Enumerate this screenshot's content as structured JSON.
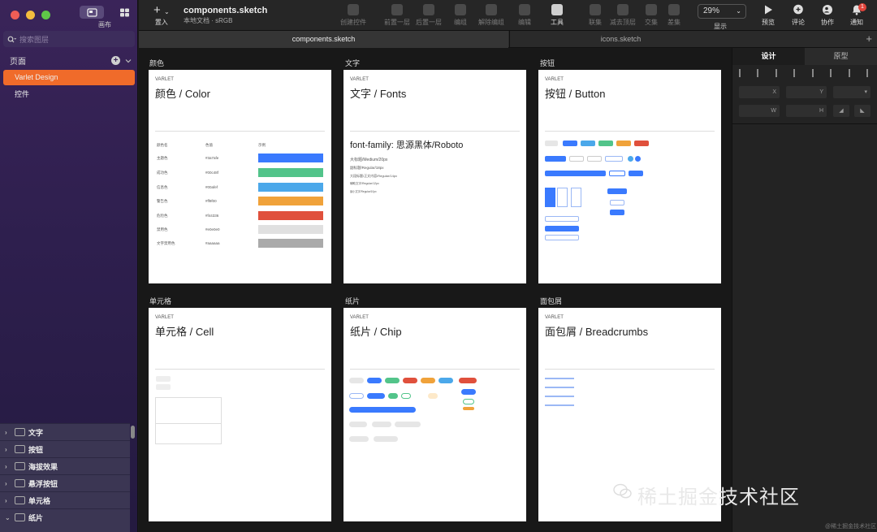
{
  "sidebar": {
    "canvas_label": "画布",
    "search_placeholder": "搜索图层",
    "pages_title": "页面",
    "pages": [
      "Varlet Design",
      "控件"
    ],
    "layers": [
      "文字",
      "按钮",
      "海拔效果",
      "悬浮按钮",
      "单元格",
      "纸片"
    ]
  },
  "toolbar": {
    "insert_label": "置入",
    "doc_title": "components.sketch",
    "doc_subtitle": "本地文档 · sRGB",
    "buttons": [
      "创建控件",
      "前置一层",
      "后置一层",
      "编组",
      "解除编组",
      "编辑",
      "工具",
      "联集",
      "减去顶层",
      "交集",
      "差集"
    ],
    "zoom_value": "29%",
    "zoom_label": "显示",
    "right_buttons": [
      "预览",
      "评论",
      "协作",
      "通知"
    ],
    "notify_count": "1"
  },
  "tabs": [
    "components.sketch",
    "icons.sketch"
  ],
  "boards": [
    {
      "label": "颜色",
      "brand": "VARLET",
      "title": "颜色 / Color"
    },
    {
      "label": "文字",
      "brand": "VARLET",
      "title": "文字 / Fonts"
    },
    {
      "label": "按钮",
      "brand": "VARLET",
      "title": "按钮 / Button"
    },
    {
      "label": "单元格",
      "brand": "VARLET",
      "title": "单元格 / Cell"
    },
    {
      "label": "纸片",
      "brand": "VARLET",
      "title": "纸片 / Chip"
    },
    {
      "label": "面包屑",
      "brand": "VARLET",
      "title": "面包屑 / Breadcrumbs"
    }
  ],
  "color_board": {
    "headers": [
      "颜色名",
      "色值",
      "示例"
    ],
    "rows": [
      {
        "name": "主题色",
        "value": "#3a7afe",
        "color": "#3a7afe"
      },
      {
        "name": "成功色",
        "value": "#00c48f",
        "color": "#52c48a"
      },
      {
        "name": "信息色",
        "value": "#00afef",
        "color": "#4ba8ea"
      },
      {
        "name": "警告色",
        "value": "#ff9f00",
        "color": "#f0a23a"
      },
      {
        "name": "危险色",
        "value": "#f44336",
        "color": "#e0503c"
      },
      {
        "name": "禁用色",
        "value": "#e0e0e0",
        "color": "#e0e0e0"
      },
      {
        "name": "文字禁用色",
        "value": "#aaaaaa",
        "color": "#aaaaaa"
      }
    ]
  },
  "font_board": {
    "family": "font-family: 思源黑体/Roboto",
    "lines": [
      "大标题/Medium/20px",
      "副标题/Regular/18px",
      "大段标题/正文内容/Regular/14px",
      "辅助文字/Regular/12px",
      "最小文字/Regular/10px"
    ]
  },
  "inspector": {
    "tabs": [
      "设计",
      "原型"
    ],
    "fields": [
      "X",
      "Y",
      "W",
      "H"
    ]
  },
  "watermark": {
    "text": "稀土掘金技术社区",
    "small": "@稀土掘金技术社区"
  }
}
